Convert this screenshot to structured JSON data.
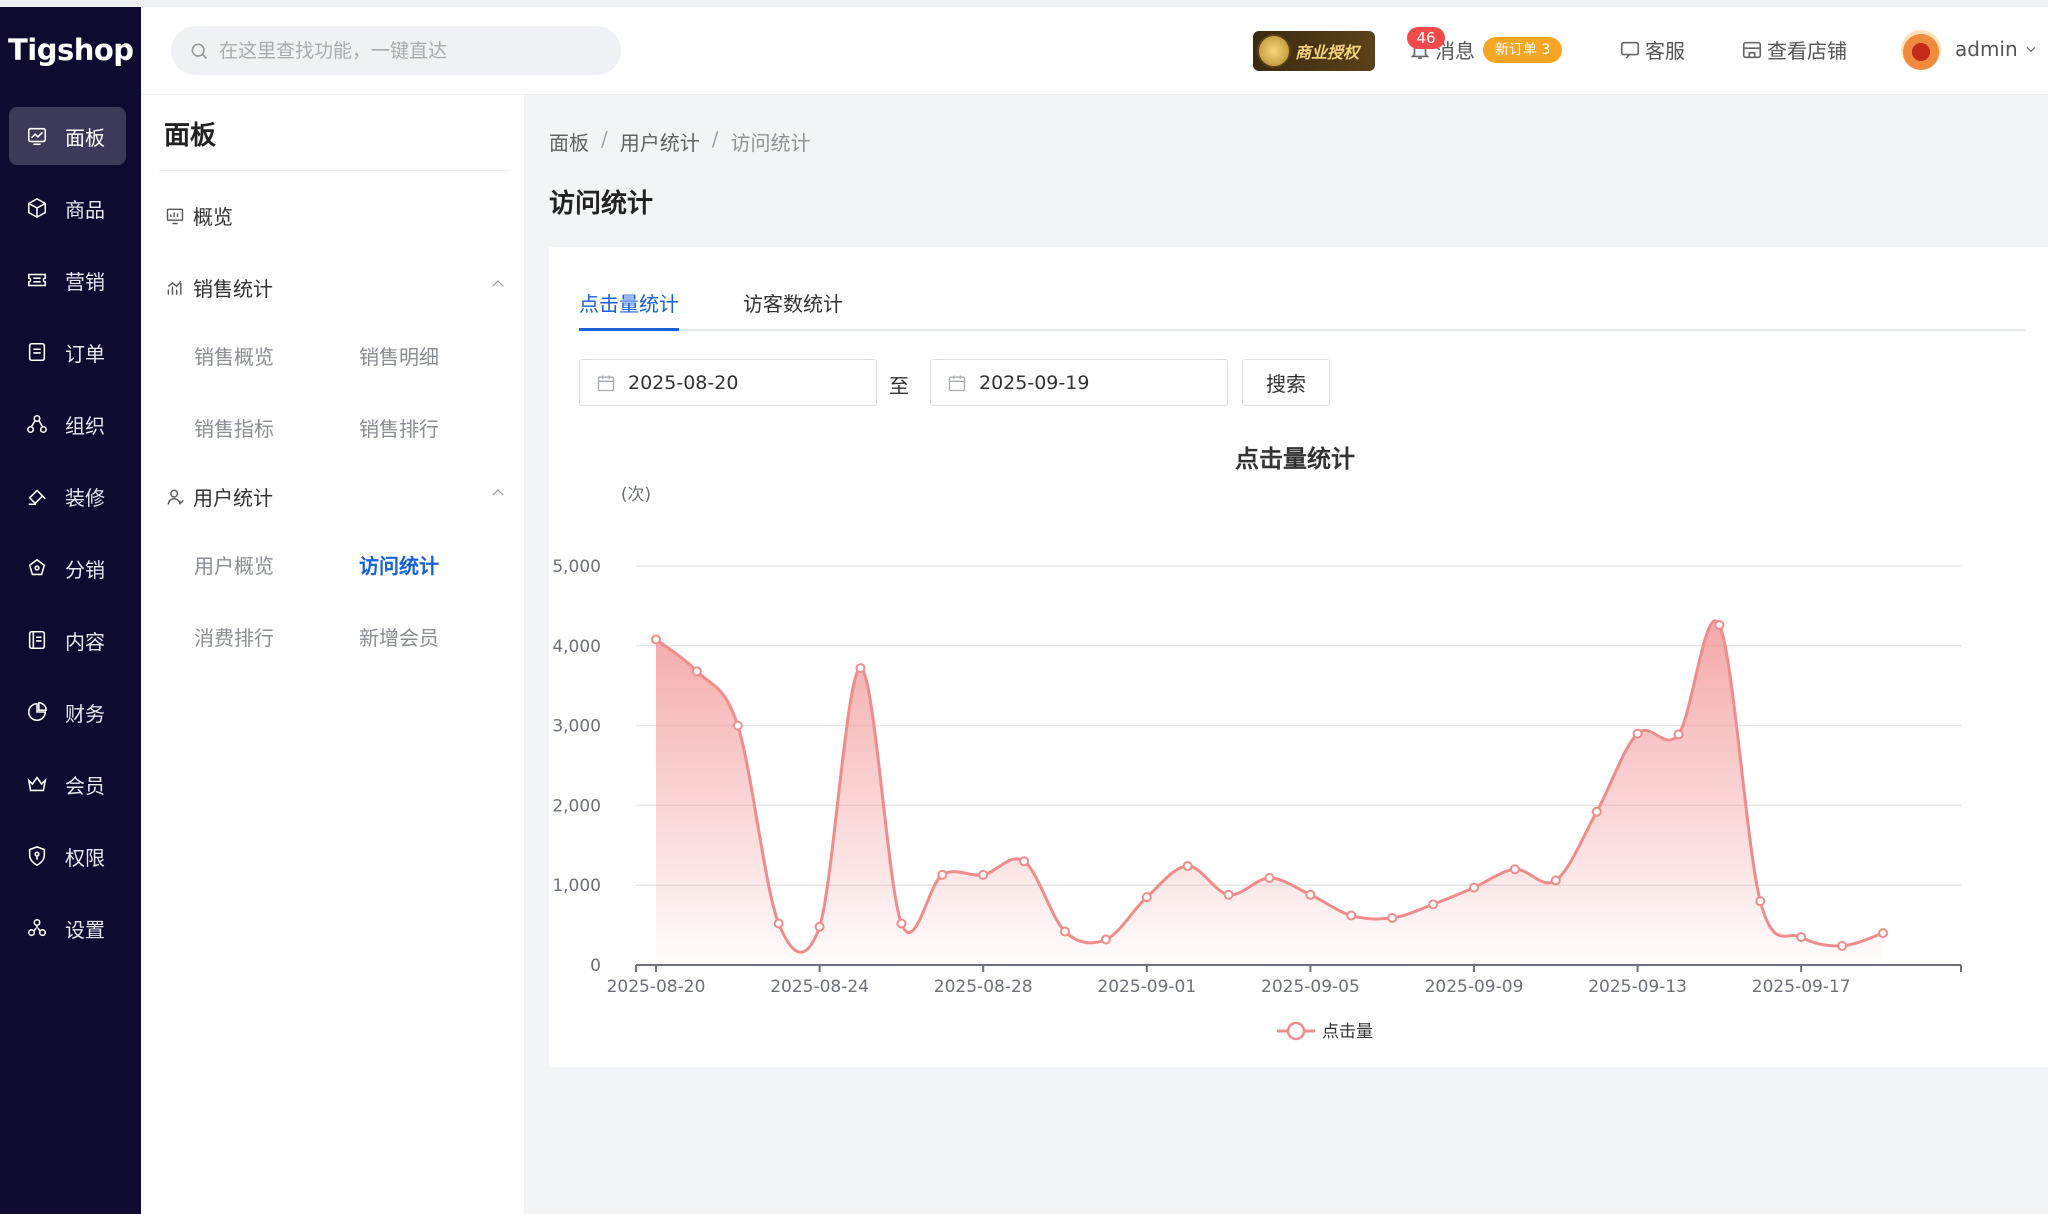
{
  "brand": {
    "logo_text": "Tigshop"
  },
  "sidebar": {
    "items": [
      {
        "label": "面板",
        "icon": "dashboard-icon",
        "active": true
      },
      {
        "label": "商品",
        "icon": "box-icon"
      },
      {
        "label": "营销",
        "icon": "ticket-icon"
      },
      {
        "label": "订单",
        "icon": "order-icon"
      },
      {
        "label": "组织",
        "icon": "org-icon"
      },
      {
        "label": "装修",
        "icon": "brush-icon"
      },
      {
        "label": "分销",
        "icon": "share-icon"
      },
      {
        "label": "内容",
        "icon": "content-icon"
      },
      {
        "label": "财务",
        "icon": "pie-icon"
      },
      {
        "label": "会员",
        "icon": "crown-icon"
      },
      {
        "label": "权限",
        "icon": "shield-icon"
      },
      {
        "label": "设置",
        "icon": "settings-icon"
      }
    ]
  },
  "header": {
    "search_placeholder": "在这里查找功能，一键直达",
    "license_label": "商业授权",
    "message_count": "46",
    "message_label": "消息",
    "new_order_label": "新订单 3",
    "service_label": "客服",
    "store_label": "查看店铺",
    "user_name": "admin"
  },
  "submenu": {
    "title": "面板",
    "overview_label": "概览",
    "sales_group": {
      "label": "销售统计",
      "items": [
        "销售概览",
        "销售明细",
        "销售指标",
        "销售排行"
      ]
    },
    "user_group": {
      "label": "用户统计",
      "items": [
        "用户概览",
        "访问统计",
        "消费排行",
        "新增会员"
      ],
      "active_item": "访问统计"
    }
  },
  "breadcrumb": [
    "面板",
    "用户统计",
    "访问统计"
  ],
  "page_title": "访问统计",
  "tabs": [
    {
      "label": "点击量统计",
      "active": true
    },
    {
      "label": "访客数统计",
      "active": false
    }
  ],
  "filters": {
    "start_date": "2025-08-20",
    "to_label": "至",
    "end_date": "2025-09-19",
    "search_button": "搜索"
  },
  "colors": {
    "accent": "#1661d8",
    "series": "#f08c8c",
    "sidebar_bg": "#0d0b2f"
  },
  "chart_data": {
    "type": "area",
    "title": "点击量统计",
    "y_unit": "(次)",
    "ylim": [
      0,
      5000
    ],
    "y_ticks": [
      "0",
      "1,000",
      "2,000",
      "3,000",
      "4,000",
      "5,000"
    ],
    "x": [
      "2025-08-20",
      "2025-08-21",
      "2025-08-22",
      "2025-08-23",
      "2025-08-24",
      "2025-08-25",
      "2025-08-26",
      "2025-08-27",
      "2025-08-28",
      "2025-08-29",
      "2025-08-30",
      "2025-08-31",
      "2025-09-01",
      "2025-09-02",
      "2025-09-03",
      "2025-09-04",
      "2025-09-05",
      "2025-09-06",
      "2025-09-07",
      "2025-09-08",
      "2025-09-09",
      "2025-09-10",
      "2025-09-11",
      "2025-09-12",
      "2025-09-13",
      "2025-09-14",
      "2025-09-15",
      "2025-09-16",
      "2025-09-17",
      "2025-09-18",
      "2025-09-19"
    ],
    "x_tick_labels": [
      "2025-08-20",
      "2025-08-24",
      "2025-08-28",
      "2025-09-01",
      "2025-09-05",
      "2025-09-09",
      "2025-09-13",
      "2025-09-17"
    ],
    "series": [
      {
        "name": "点击量",
        "values": [
          4080,
          3680,
          3000,
          520,
          480,
          3720,
          520,
          1130,
          1130,
          1300,
          420,
          320,
          850,
          1240,
          880,
          1090,
          880,
          620,
          590,
          760,
          970,
          1200,
          1060,
          1920,
          2900,
          2890,
          4260,
          800,
          350,
          240,
          400
        ]
      }
    ],
    "legend": "bottom-center",
    "grid": true
  }
}
